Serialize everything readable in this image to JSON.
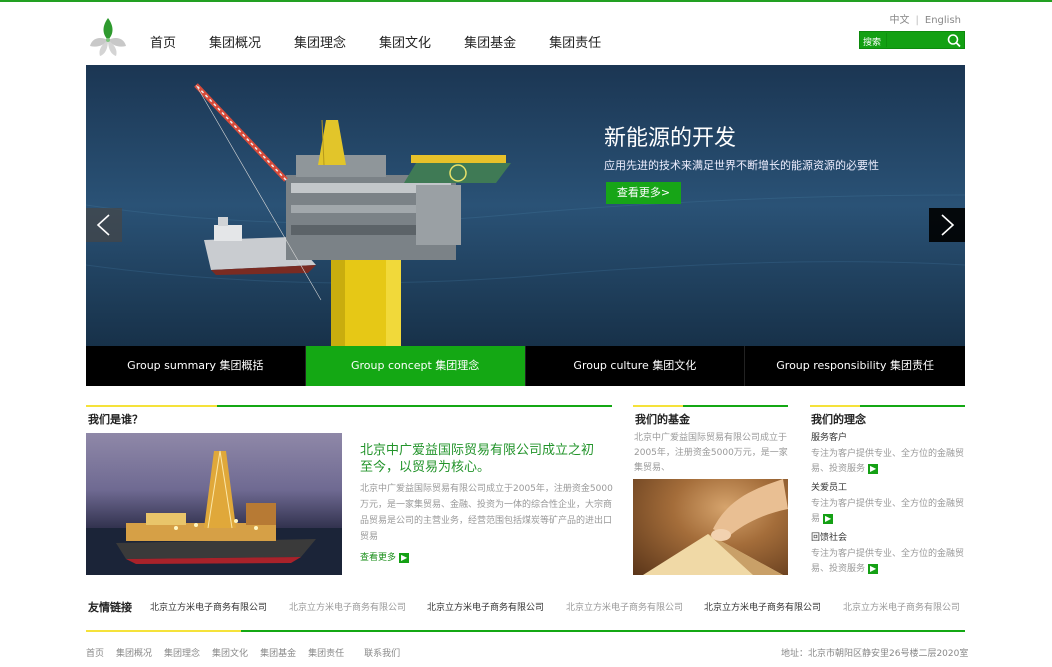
{
  "header": {
    "lang_cn": "中文",
    "lang_en": "English",
    "search_label": "搜索",
    "nav": [
      "首页",
      "集团概况",
      "集团理念",
      "集团文化",
      "集团基金",
      "集团责任"
    ]
  },
  "banner": {
    "title": "新能源的开发",
    "subtitle": "应用先进的技术来满足世界不断增长的能源资源的必要性",
    "button": "查看更多>"
  },
  "tabs": [
    {
      "label": "Group summary 集团概括",
      "active": false
    },
    {
      "label": "Group concept 集团理念",
      "active": true
    },
    {
      "label": "Group culture 集团文化",
      "active": false
    },
    {
      "label": "Group responsibility  集团责任",
      "active": false
    }
  ],
  "who": {
    "heading": "我们是谁？",
    "title": "北京中广爱益国际贸易有限公司成立之初至今，以贸易为核心。",
    "text": "北京中广爱益国际贸易有限公司成立于2005年，注册资金5000万元，是一家集贸易、金融、投资为一体的综合性企业，大宗商品贸易是公司的主营业务，经营范围包括煤炭等矿产品的进出口贸易",
    "more": "查看更多"
  },
  "fund": {
    "heading": "我们的基金",
    "text": "北京中广爱益国际贸易有限公司成立于2005年，注册资金5000万元，是一家集贸易、"
  },
  "concept": {
    "heading": "我们的理念",
    "items": [
      {
        "title": "服务客户",
        "desc": "专注为客户提供专业、全方位的金融贸易、投资服务"
      },
      {
        "title": "关爱员工",
        "desc": "专注为客户提供专业、全方位的金融贸易"
      },
      {
        "title": "回馈社会",
        "desc": "专注为客户提供专业、全方位的金融贸易、投资服务"
      }
    ]
  },
  "links": {
    "label": "友情链接",
    "items": [
      "北京立方米电子商务有限公司",
      "北京立方米电子商务有限公司",
      "北京立方米电子商务有限公司",
      "北京立方米电子商务有限公司",
      "北京立方米电子商务有限公司",
      "北京立方米电子商务有限公司"
    ]
  },
  "footer": {
    "nav": [
      "首页",
      "集团概况",
      "集团理念",
      "集团文化",
      "集团基金",
      "集团责任",
      "联系我们"
    ],
    "address": "地址：北京市朝阳区静安里26号楼二层2020室"
  },
  "colors": {
    "accent": "#14a814",
    "yellow": "#f5e23a"
  },
  "icons": [
    "logo-icon",
    "search-icon",
    "arrow-left-icon",
    "arrow-right-icon",
    "more-arrow-icon"
  ]
}
